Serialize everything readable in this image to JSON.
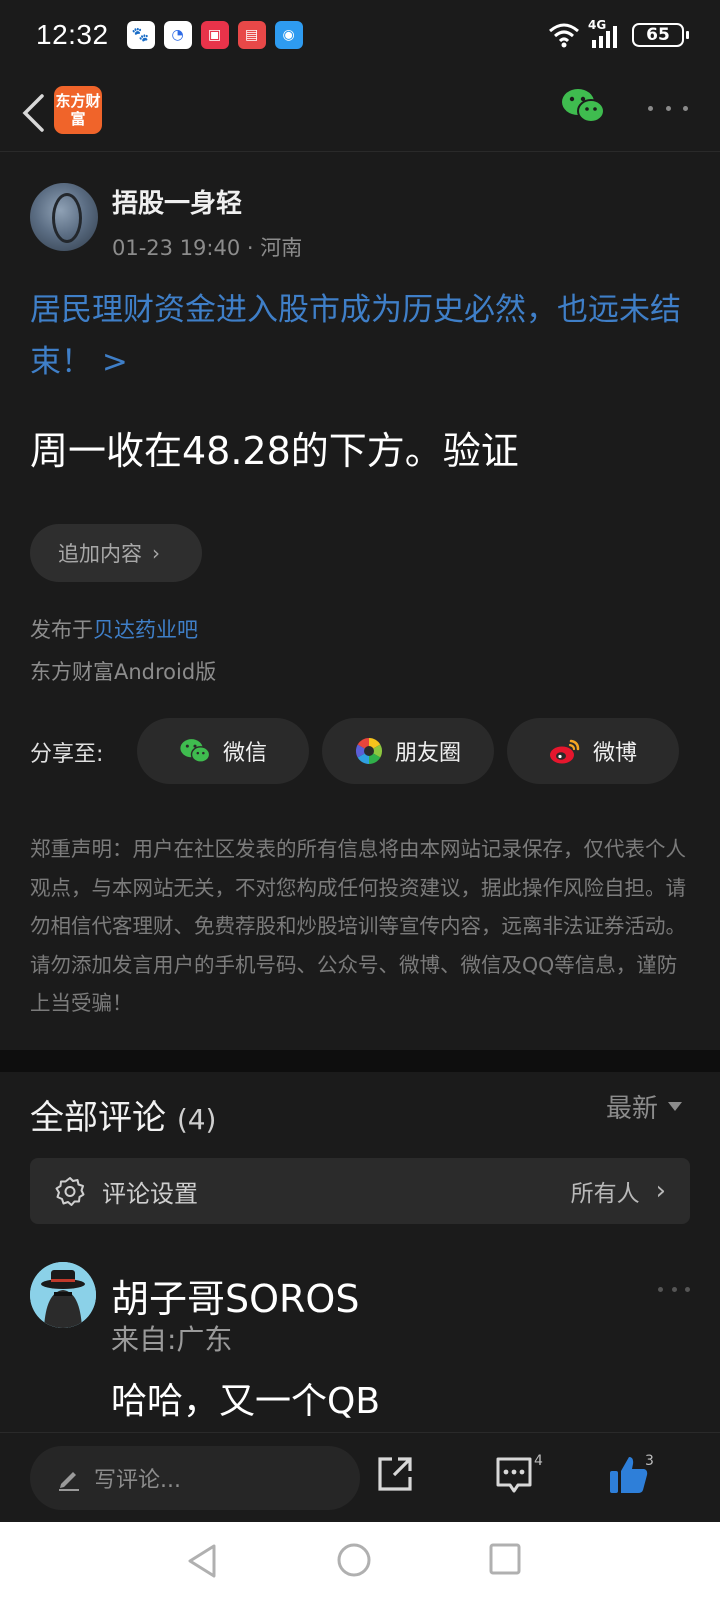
{
  "status_bar": {
    "time": "12:32",
    "battery": "65",
    "network": "4G"
  },
  "nav": {
    "logo_text": "东方财富",
    "back_icon": "back-arrow-icon",
    "share_icon": "wechat-icon",
    "more_icon": "more-dots-icon"
  },
  "post": {
    "author": "捂股一身轻",
    "datetime": "01-23 19:40",
    "location": "· 河南",
    "headline": "居民理财资金进入股市成为历史必然，也远未结束！ >",
    "content": "周一收在48.28的下方。验证",
    "add_content_label": "追加内容",
    "published_prefix": "发布于",
    "bar_name": "贝达药业吧",
    "app_source": "东方财富Android版"
  },
  "share": {
    "label": "分享至:",
    "buttons": [
      {
        "label": "微信",
        "icon": "wechat-icon"
      },
      {
        "label": "朋友圈",
        "icon": "moments-icon"
      },
      {
        "label": "微博",
        "icon": "weibo-icon"
      }
    ]
  },
  "disclaimer": "郑重声明：用户在社区发表的所有信息将由本网站记录保存，仅代表个人观点，与本网站无关，不对您构成任何投资建议，据此操作风险自担。请勿相信代客理财、免费荐股和炒股培训等宣传内容，远离非法证券活动。请勿添加发言用户的手机号码、公众号、微博、微信及QQ等信息，谨防上当受骗！",
  "comments": {
    "title": "全部评论",
    "count": "(4)",
    "sort": "最新",
    "settings_label": "评论设置",
    "settings_value": "所有人",
    "items": [
      {
        "name": "胡子哥SOROS",
        "from": "来自:广东",
        "text": "哈哈，又一个QB"
      }
    ]
  },
  "bottom_bar": {
    "write_placeholder": "写评论...",
    "comment_count": "4",
    "like_count": "3"
  },
  "colors": {
    "accent_blue": "#3f7fc8",
    "brand_orange": "#f0642a",
    "wechat_green": "#3fbc4f",
    "like_blue": "#2e7fd9"
  }
}
